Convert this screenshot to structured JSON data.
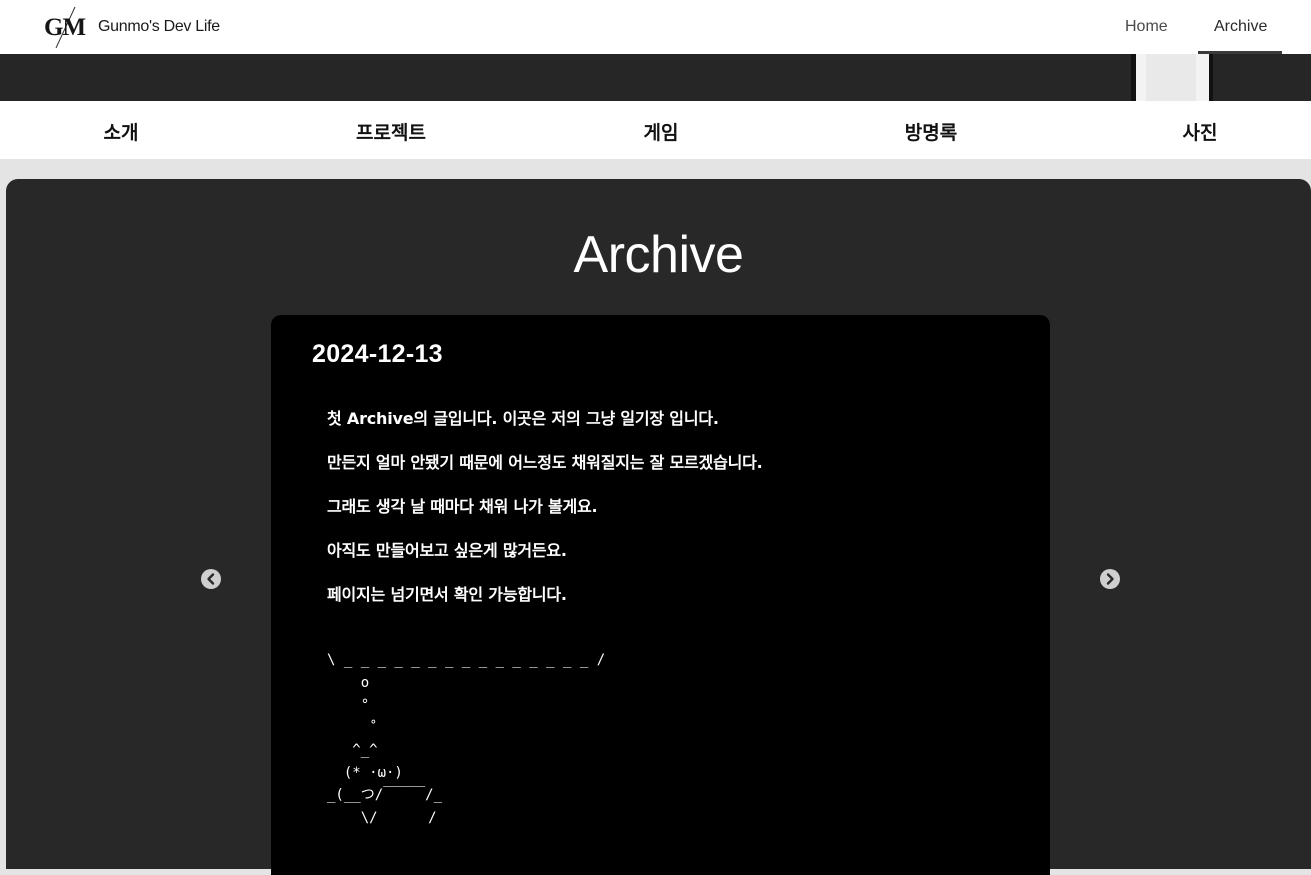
{
  "header": {
    "logo_text": "GM",
    "brand": "Gunmo's Dev Life",
    "nav": {
      "home": "Home",
      "archive": "Archive"
    }
  },
  "subnav": {
    "items": [
      "소개",
      "프로젝트",
      "게임",
      "방명록",
      "사진"
    ]
  },
  "main": {
    "title": "Archive",
    "post": {
      "date": "2024-12-13",
      "lines": [
        "첫 Archive의 글입니다. 이곳은 저의 그냥 일기장 입니다.",
        "만든지 얼마 안됐기 때문에 어느정도 채워질지는 잘 모르겠습니다.",
        "그래도 생각 날 때마다 채워 나가 볼게요.",
        "아직도 만들어보고 싶은게 많거든요.",
        "페이지는 넘기면서 확인 가능합니다."
      ],
      "ascii_art": "\\ _ _ _ _ _ _ _ _ _ _ _ _ _ _ _ /\n    o\n    °\n     ˚\n   ^_^\n  (* ·ω·)\n_(__つ/￣￣￣/_\n    \\/      /"
    }
  },
  "colors": {
    "background": "#e4e4e4",
    "banner": "#262626",
    "main_panel": "#282828",
    "post_card": "#000000",
    "text_light": "#ffffff"
  }
}
